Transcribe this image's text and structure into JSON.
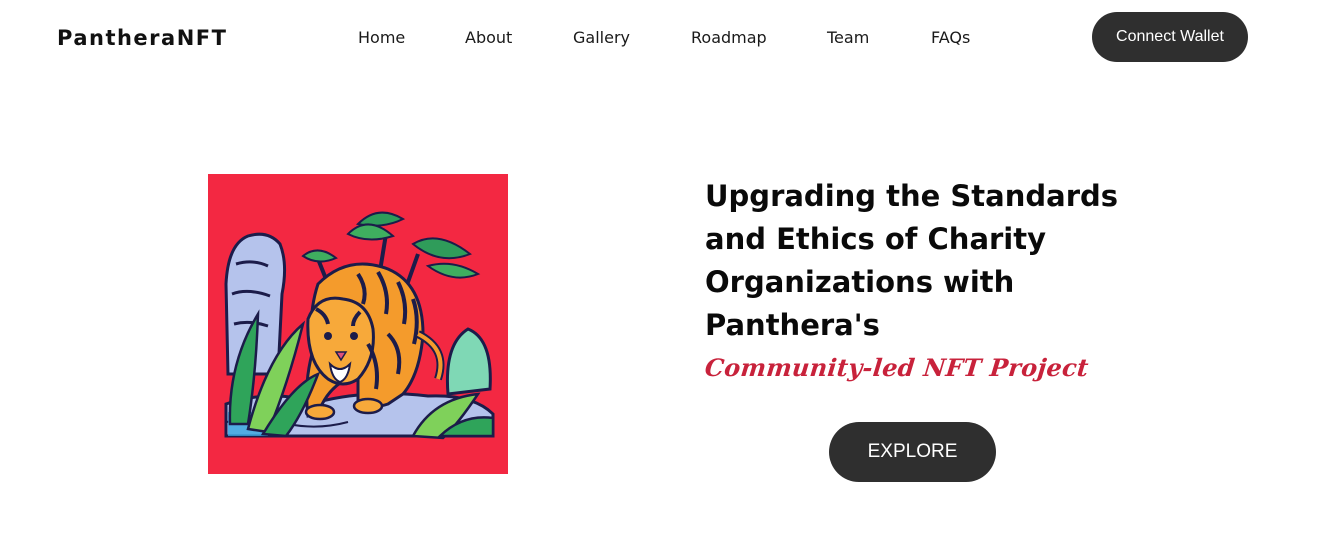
{
  "brand": {
    "logo_text": "PantheraNFT"
  },
  "nav": {
    "items": [
      {
        "label": "Home"
      },
      {
        "label": "About"
      },
      {
        "label": "Gallery"
      },
      {
        "label": "Roadmap"
      },
      {
        "label": "Team"
      },
      {
        "label": "FAQs"
      }
    ]
  },
  "header": {
    "connect_label": "Connect Wallet"
  },
  "hero": {
    "headline": "Upgrading the Standards and Ethics of Charity Organizations with Panthera's",
    "tagline": "Community-led NFT Project",
    "explore_label": "EXPLORE",
    "art_subject": "tiger-in-jungle-illustration"
  },
  "colors": {
    "button_bg": "#2f2f2f",
    "accent_red": "#f32842",
    "tagline_red": "#c8223b",
    "text": "#0a0a0a"
  }
}
